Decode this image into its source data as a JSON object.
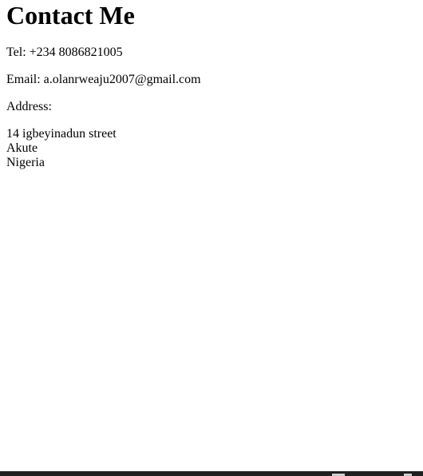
{
  "page": {
    "title": "Contact Me",
    "tel": "Tel: +234 8086821005",
    "email": "Email: a.olanrweaju2007@gmail.com",
    "address_label": "Address:",
    "address_lines": [
      "14 igbeyinadun street",
      "Akute",
      "Nigeria"
    ]
  }
}
